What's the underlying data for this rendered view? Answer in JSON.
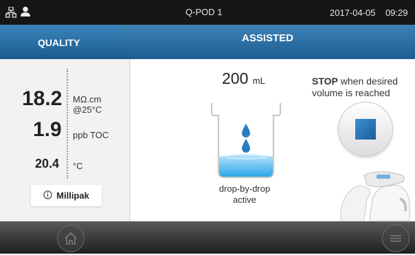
{
  "status_bar": {
    "device_name": "Q-POD 1",
    "date": "2017-04-05",
    "time": "09:29",
    "network_icon": "network-icon",
    "user_icon": "user-icon"
  },
  "header": {
    "quality_tab": "QUALITY",
    "mode_title": "ASSISTED"
  },
  "quality": {
    "resistivity_value": "18.2",
    "resistivity_unit": "MΩ.cm",
    "resistivity_temp": "@25°C",
    "toc_value": "1.9",
    "toc_unit": "ppb TOC",
    "temperature_value": "20.4",
    "temperature_unit": "°C",
    "cartridge_label": "Millipak",
    "info_icon": "info-icon"
  },
  "dispense": {
    "volume_value": "200",
    "volume_unit": "mL",
    "mode_line1": "drop-by-drop",
    "mode_line2": "active",
    "stop_bold": "STOP",
    "stop_rest": " when desired volume is reached",
    "accent_color": "#2a7fc4"
  },
  "footer": {
    "home_icon": "home-icon",
    "menu_icon": "menu-icon"
  }
}
